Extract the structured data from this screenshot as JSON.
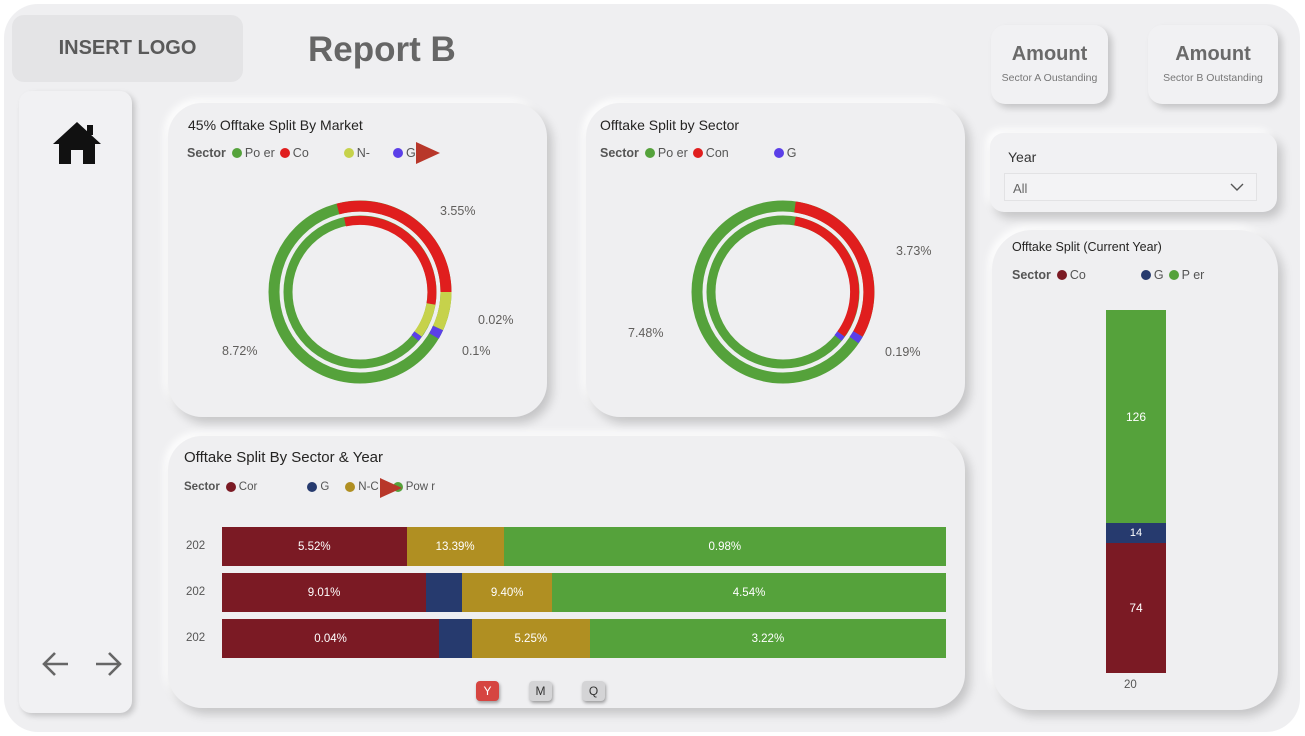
{
  "header": {
    "logo_text": "INSERT LOGO",
    "report_title": "Report B"
  },
  "kpis": [
    {
      "value": "Amount",
      "label": "Sector A Oustanding"
    },
    {
      "value": "Amount",
      "label": "Sector B Outstanding"
    }
  ],
  "year_slicer": {
    "label": "Year",
    "value": "All"
  },
  "market_chart": {
    "title": "45% Offtake Split By Market",
    "legend_title": "Sector",
    "legend": [
      {
        "label": "Po  er",
        "color": "#55a23b"
      },
      {
        "label": "Co",
        "color": "#e01e1e"
      },
      {
        "label": "N-",
        "color": "#c6d24b"
      },
      {
        "label": "G",
        "color": "#5b3fe8"
      }
    ],
    "labels": [
      "3.55%",
      "0.02%",
      "0.1%",
      "8.72%"
    ]
  },
  "sector_chart": {
    "title": "Offtake Split by Sector",
    "legend_title": "Sector",
    "legend": [
      {
        "label": "Po  er",
        "color": "#55a23b"
      },
      {
        "label": "Con",
        "color": "#e01e1e"
      },
      {
        "label": "G",
        "color": "#5b3fe8"
      }
    ],
    "labels": [
      "3.73%",
      "0.19%",
      "7.48%"
    ]
  },
  "current_year_chart": {
    "title": "Offtake Split (Current Year)",
    "legend_title": "Sector",
    "legend": [
      {
        "label": "Co",
        "color": "#7b1a24"
      },
      {
        "label": "G",
        "color": "#263a6e"
      },
      {
        "label": "P  er",
        "color": "#55a23b"
      }
    ],
    "segments": [
      {
        "label": "126",
        "color": "#55a23b"
      },
      {
        "label": "14",
        "color": "#263a6e"
      },
      {
        "label": "74",
        "color": "#7b1a24"
      }
    ],
    "x_label": "20"
  },
  "year_chart": {
    "title": "Offtake Split By Sector & Year",
    "legend_title": "Sector",
    "legend": [
      {
        "label": "Cor",
        "color": "#7b1a24"
      },
      {
        "label": "G",
        "color": "#263a6e"
      },
      {
        "label": "N-C",
        "color": "#b08f22"
      },
      {
        "label": "Pow  r",
        "color": "#55a23b"
      }
    ],
    "rows": [
      {
        "year": "202",
        "segments": [
          {
            "share": 0.255,
            "label": "5.52%",
            "color": "#7b1a24"
          },
          {
            "share": 0.134,
            "label": "13.39%",
            "color": "#b08f22"
          },
          {
            "share": 0.611,
            "label": "0.98%",
            "color": "#55a23b"
          }
        ]
      },
      {
        "year": "202",
        "segments": [
          {
            "share": 0.282,
            "label": "9.01%",
            "color": "#7b1a24"
          },
          {
            "share": 0.05,
            "label": "",
            "color": "#263a6e"
          },
          {
            "share": 0.124,
            "label": "9.40%",
            "color": "#b08f22"
          },
          {
            "share": 0.544,
            "label": "4.54%",
            "color": "#55a23b"
          }
        ]
      },
      {
        "year": "202",
        "segments": [
          {
            "share": 0.3,
            "label": "0.04%",
            "color": "#7b1a24"
          },
          {
            "share": 0.045,
            "label": "",
            "color": "#263a6e"
          },
          {
            "share": 0.163,
            "label": "5.25%",
            "color": "#b08f22"
          },
          {
            "share": 0.492,
            "label": "3.22%",
            "color": "#55a23b"
          }
        ]
      }
    ],
    "buttons": [
      "Y",
      "M",
      "Q"
    ]
  }
}
